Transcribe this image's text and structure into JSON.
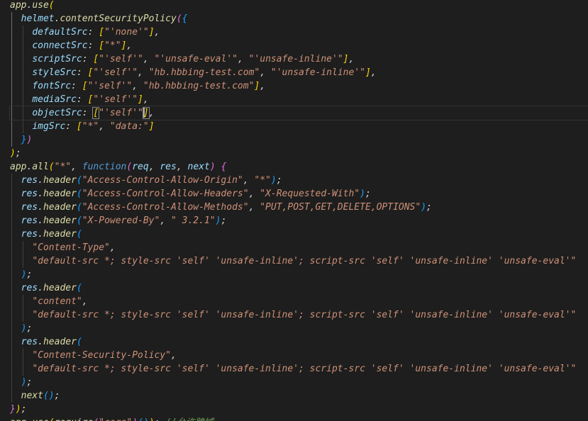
{
  "editor": {
    "language": "javascript",
    "theme_colors": {
      "background": "#1e1e1e",
      "identifier": "#9cdcfe",
      "function": "#dcdcaa",
      "string": "#ce9178",
      "keyword": "#569cd6",
      "comment": "#6a9955"
    },
    "lines": [
      [
        {
          "c": "tok-fn",
          "t": "app"
        },
        {
          "c": "tok-pun",
          "t": "."
        },
        {
          "c": "tok-fn",
          "t": "use"
        },
        {
          "c": "tok-brk",
          "t": "("
        }
      ],
      [
        {
          "c": "tok-pun",
          "t": "  "
        },
        {
          "c": "tok-obj",
          "t": "helmet"
        },
        {
          "c": "tok-pun",
          "t": "."
        },
        {
          "c": "tok-fn",
          "t": "contentSecurityPolicy"
        },
        {
          "c": "tok-brk2",
          "t": "("
        },
        {
          "c": "tok-brk3",
          "t": "{"
        }
      ],
      [
        {
          "c": "tok-pun",
          "t": "    "
        },
        {
          "c": "tok-key",
          "t": "defaultSrc"
        },
        {
          "c": "tok-pun",
          "t": ": "
        },
        {
          "c": "tok-brk",
          "t": "["
        },
        {
          "c": "tok-str",
          "t": "\"'none'\""
        },
        {
          "c": "tok-brk",
          "t": "]"
        },
        {
          "c": "tok-pun",
          "t": ","
        }
      ],
      [
        {
          "c": "tok-pun",
          "t": "    "
        },
        {
          "c": "tok-key",
          "t": "connectSrc"
        },
        {
          "c": "tok-pun",
          "t": ": "
        },
        {
          "c": "tok-brk",
          "t": "["
        },
        {
          "c": "tok-str",
          "t": "\"*\""
        },
        {
          "c": "tok-brk",
          "t": "]"
        },
        {
          "c": "tok-pun",
          "t": ","
        }
      ],
      [
        {
          "c": "tok-pun",
          "t": "    "
        },
        {
          "c": "tok-key",
          "t": "scriptSrc"
        },
        {
          "c": "tok-pun",
          "t": ": "
        },
        {
          "c": "tok-brk",
          "t": "["
        },
        {
          "c": "tok-str",
          "t": "\"'self'\""
        },
        {
          "c": "tok-pun",
          "t": ", "
        },
        {
          "c": "tok-str",
          "t": "\"'unsafe-eval'\""
        },
        {
          "c": "tok-pun",
          "t": ", "
        },
        {
          "c": "tok-str",
          "t": "\"'unsafe-inline'\""
        },
        {
          "c": "tok-brk",
          "t": "]"
        },
        {
          "c": "tok-pun",
          "t": ","
        }
      ],
      [
        {
          "c": "tok-pun",
          "t": "    "
        },
        {
          "c": "tok-key",
          "t": "styleSrc"
        },
        {
          "c": "tok-pun",
          "t": ": "
        },
        {
          "c": "tok-brk",
          "t": "["
        },
        {
          "c": "tok-str",
          "t": "\"'self'\""
        },
        {
          "c": "tok-pun",
          "t": ", "
        },
        {
          "c": "tok-str",
          "t": "\"hb.hbbing-test.com\""
        },
        {
          "c": "tok-pun",
          "t": ", "
        },
        {
          "c": "tok-str",
          "t": "\"'unsafe-inline'\""
        },
        {
          "c": "tok-brk",
          "t": "]"
        },
        {
          "c": "tok-pun",
          "t": ","
        }
      ],
      [
        {
          "c": "tok-pun",
          "t": "    "
        },
        {
          "c": "tok-key",
          "t": "fontSrc"
        },
        {
          "c": "tok-pun",
          "t": ": "
        },
        {
          "c": "tok-brk",
          "t": "["
        },
        {
          "c": "tok-str",
          "t": "\"'self'\""
        },
        {
          "c": "tok-pun",
          "t": ", "
        },
        {
          "c": "tok-str",
          "t": "\"hb.hbbing-test.com\""
        },
        {
          "c": "tok-brk",
          "t": "]"
        },
        {
          "c": "tok-pun",
          "t": ","
        }
      ],
      [
        {
          "c": "tok-pun",
          "t": "    "
        },
        {
          "c": "tok-key",
          "t": "mediaSrc"
        },
        {
          "c": "tok-pun",
          "t": ": "
        },
        {
          "c": "tok-brk",
          "t": "["
        },
        {
          "c": "tok-str",
          "t": "\"'self'\""
        },
        {
          "c": "tok-brk",
          "t": "]"
        },
        {
          "c": "tok-pun",
          "t": ","
        }
      ],
      [
        {
          "c": "tok-pun",
          "t": "    "
        },
        {
          "c": "tok-key",
          "t": "objectSrc"
        },
        {
          "c": "tok-pun",
          "t": ": "
        },
        {
          "c": "tok-brk cursor-bracket",
          "t": "["
        },
        {
          "c": "tok-str",
          "t": "\"'self'\""
        },
        {
          "c": "caret",
          "t": ""
        },
        {
          "c": "tok-brk cursor-bracket",
          "t": "]"
        },
        {
          "c": "tok-pun",
          "t": ","
        }
      ],
      [
        {
          "c": "tok-pun",
          "t": "    "
        },
        {
          "c": "tok-key",
          "t": "imgSrc"
        },
        {
          "c": "tok-pun",
          "t": ": "
        },
        {
          "c": "tok-brk",
          "t": "["
        },
        {
          "c": "tok-str",
          "t": "\"*\""
        },
        {
          "c": "tok-pun",
          "t": ", "
        },
        {
          "c": "tok-str",
          "t": "\"data:\""
        },
        {
          "c": "tok-brk",
          "t": "]"
        }
      ],
      [
        {
          "c": "tok-pun",
          "t": "  "
        },
        {
          "c": "tok-brk3",
          "t": "}"
        },
        {
          "c": "tok-brk2",
          "t": ")"
        }
      ],
      [
        {
          "c": "tok-brk",
          "t": ")"
        },
        {
          "c": "tok-pun",
          "t": ";"
        }
      ],
      [
        {
          "c": "tok-fn",
          "t": "app"
        },
        {
          "c": "tok-pun",
          "t": "."
        },
        {
          "c": "tok-fn",
          "t": "all"
        },
        {
          "c": "tok-brk",
          "t": "("
        },
        {
          "c": "tok-str",
          "t": "\"*\""
        },
        {
          "c": "tok-pun",
          "t": ", "
        },
        {
          "c": "tok-kw",
          "t": "function"
        },
        {
          "c": "tok-brk2",
          "t": "("
        },
        {
          "c": "tok-obj",
          "t": "req"
        },
        {
          "c": "tok-pun",
          "t": ", "
        },
        {
          "c": "tok-obj",
          "t": "res"
        },
        {
          "c": "tok-pun",
          "t": ", "
        },
        {
          "c": "tok-obj",
          "t": "next"
        },
        {
          "c": "tok-brk2",
          "t": ")"
        },
        {
          "c": "tok-pun",
          "t": " "
        },
        {
          "c": "tok-brk2",
          "t": "{"
        }
      ],
      [
        {
          "c": "tok-pun",
          "t": "  "
        },
        {
          "c": "tok-obj",
          "t": "res"
        },
        {
          "c": "tok-pun",
          "t": "."
        },
        {
          "c": "tok-fn",
          "t": "header"
        },
        {
          "c": "tok-brk3",
          "t": "("
        },
        {
          "c": "tok-str",
          "t": "\"Access-Control-Allow-Origin\""
        },
        {
          "c": "tok-pun",
          "t": ", "
        },
        {
          "c": "tok-str",
          "t": "\"*\""
        },
        {
          "c": "tok-brk3",
          "t": ")"
        },
        {
          "c": "tok-pun",
          "t": ";"
        }
      ],
      [
        {
          "c": "tok-pun",
          "t": "  "
        },
        {
          "c": "tok-obj",
          "t": "res"
        },
        {
          "c": "tok-pun",
          "t": "."
        },
        {
          "c": "tok-fn",
          "t": "header"
        },
        {
          "c": "tok-brk3",
          "t": "("
        },
        {
          "c": "tok-str",
          "t": "\"Access-Control-Allow-Headers\""
        },
        {
          "c": "tok-pun",
          "t": ", "
        },
        {
          "c": "tok-str",
          "t": "\"X-Requested-With\""
        },
        {
          "c": "tok-brk3",
          "t": ")"
        },
        {
          "c": "tok-pun",
          "t": ";"
        }
      ],
      [
        {
          "c": "tok-pun",
          "t": "  "
        },
        {
          "c": "tok-obj",
          "t": "res"
        },
        {
          "c": "tok-pun",
          "t": "."
        },
        {
          "c": "tok-fn",
          "t": "header"
        },
        {
          "c": "tok-brk3",
          "t": "("
        },
        {
          "c": "tok-str",
          "t": "\"Access-Control-Allow-Methods\""
        },
        {
          "c": "tok-pun",
          "t": ", "
        },
        {
          "c": "tok-str",
          "t": "\"PUT,POST,GET,DELETE,OPTIONS\""
        },
        {
          "c": "tok-brk3",
          "t": ")"
        },
        {
          "c": "tok-pun",
          "t": ";"
        }
      ],
      [
        {
          "c": "tok-pun",
          "t": "  "
        },
        {
          "c": "tok-obj",
          "t": "res"
        },
        {
          "c": "tok-pun",
          "t": "."
        },
        {
          "c": "tok-fn",
          "t": "header"
        },
        {
          "c": "tok-brk3",
          "t": "("
        },
        {
          "c": "tok-str",
          "t": "\"X-Powered-By\""
        },
        {
          "c": "tok-pun",
          "t": ", "
        },
        {
          "c": "tok-str",
          "t": "\" 3.2.1\""
        },
        {
          "c": "tok-brk3",
          "t": ")"
        },
        {
          "c": "tok-pun",
          "t": ";"
        }
      ],
      [
        {
          "c": "tok-pun",
          "t": "  "
        },
        {
          "c": "tok-obj",
          "t": "res"
        },
        {
          "c": "tok-pun",
          "t": "."
        },
        {
          "c": "tok-fn",
          "t": "header"
        },
        {
          "c": "tok-brk3",
          "t": "("
        }
      ],
      [
        {
          "c": "tok-pun",
          "t": "    "
        },
        {
          "c": "tok-str",
          "t": "\"Content-Type\""
        },
        {
          "c": "tok-pun",
          "t": ","
        }
      ],
      [
        {
          "c": "tok-pun",
          "t": "    "
        },
        {
          "c": "tok-str",
          "t": "\"default-src *; style-src 'self' 'unsafe-inline'; script-src 'self' 'unsafe-inline' 'unsafe-eval'\""
        }
      ],
      [
        {
          "c": "tok-pun",
          "t": "  "
        },
        {
          "c": "tok-brk3",
          "t": ")"
        },
        {
          "c": "tok-pun",
          "t": ";"
        }
      ],
      [
        {
          "c": "tok-pun",
          "t": "  "
        },
        {
          "c": "tok-obj",
          "t": "res"
        },
        {
          "c": "tok-pun",
          "t": "."
        },
        {
          "c": "tok-fn",
          "t": "header"
        },
        {
          "c": "tok-brk3",
          "t": "("
        }
      ],
      [
        {
          "c": "tok-pun",
          "t": "    "
        },
        {
          "c": "tok-str",
          "t": "\"content\""
        },
        {
          "c": "tok-pun",
          "t": ","
        }
      ],
      [
        {
          "c": "tok-pun",
          "t": "    "
        },
        {
          "c": "tok-str",
          "t": "\"default-src *; style-src 'self' 'unsafe-inline'; script-src 'self' 'unsafe-inline' 'unsafe-eval'\""
        }
      ],
      [
        {
          "c": "tok-pun",
          "t": "  "
        },
        {
          "c": "tok-brk3",
          "t": ")"
        },
        {
          "c": "tok-pun",
          "t": ";"
        }
      ],
      [
        {
          "c": "tok-pun",
          "t": "  "
        },
        {
          "c": "tok-obj",
          "t": "res"
        },
        {
          "c": "tok-pun",
          "t": "."
        },
        {
          "c": "tok-fn",
          "t": "header"
        },
        {
          "c": "tok-brk3",
          "t": "("
        }
      ],
      [
        {
          "c": "tok-pun",
          "t": "    "
        },
        {
          "c": "tok-str",
          "t": "\"Content-Security-Policy\""
        },
        {
          "c": "tok-pun",
          "t": ","
        }
      ],
      [
        {
          "c": "tok-pun",
          "t": "    "
        },
        {
          "c": "tok-str",
          "t": "\"default-src *; style-src 'self' 'unsafe-inline'; script-src 'self' 'unsafe-inline' 'unsafe-eval'\""
        }
      ],
      [
        {
          "c": "tok-pun",
          "t": "  "
        },
        {
          "c": "tok-brk3",
          "t": ")"
        },
        {
          "c": "tok-pun",
          "t": ";"
        }
      ],
      [
        {
          "c": "tok-pun",
          "t": "  "
        },
        {
          "c": "tok-fn",
          "t": "next"
        },
        {
          "c": "tok-brk3",
          "t": "()"
        },
        {
          "c": "tok-pun",
          "t": ";"
        }
      ],
      [
        {
          "c": "tok-brk2",
          "t": "}"
        },
        {
          "c": "tok-brk",
          "t": ")"
        },
        {
          "c": "tok-pun",
          "t": ";"
        }
      ],
      [
        {
          "c": "tok-fn",
          "t": "app"
        },
        {
          "c": "tok-pun",
          "t": "."
        },
        {
          "c": "tok-fn",
          "t": "use"
        },
        {
          "c": "tok-brk",
          "t": "("
        },
        {
          "c": "tok-fn",
          "t": "require"
        },
        {
          "c": "tok-brk2",
          "t": "("
        },
        {
          "c": "tok-str",
          "t": "\"cors\""
        },
        {
          "c": "tok-brk2",
          "t": ")"
        },
        {
          "c": "tok-brk3",
          "t": "()"
        },
        {
          "c": "tok-brk",
          "t": ")"
        },
        {
          "c": "tok-pun",
          "t": "; "
        },
        {
          "c": "tok-cmt",
          "t": "//允许跨域"
        }
      ]
    ],
    "current_line_index": 8
  }
}
